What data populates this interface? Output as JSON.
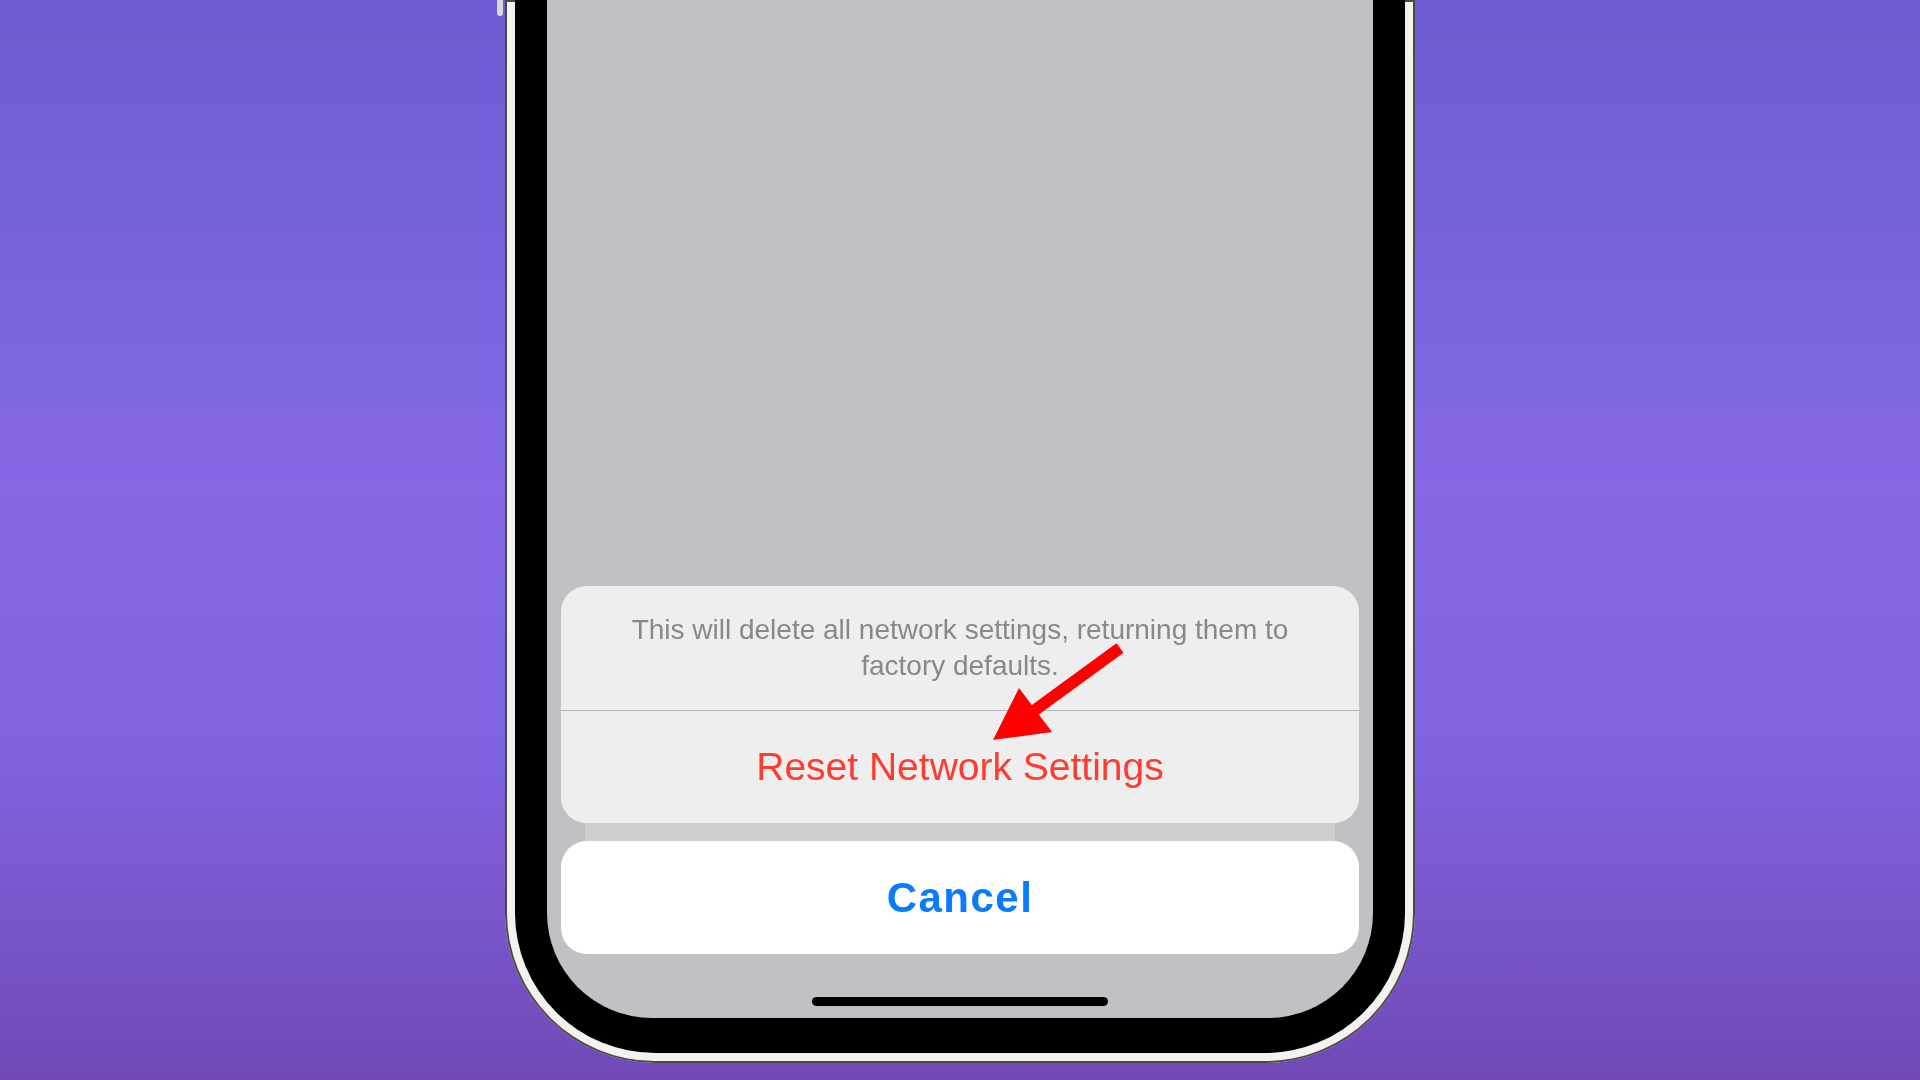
{
  "action_sheet": {
    "message": "This will delete all network settings, returning them to factory defaults.",
    "actions": [
      {
        "label": "Reset Network Settings",
        "kind": "destructive"
      }
    ]
  },
  "cancel_button": {
    "label": "Cancel"
  }
}
